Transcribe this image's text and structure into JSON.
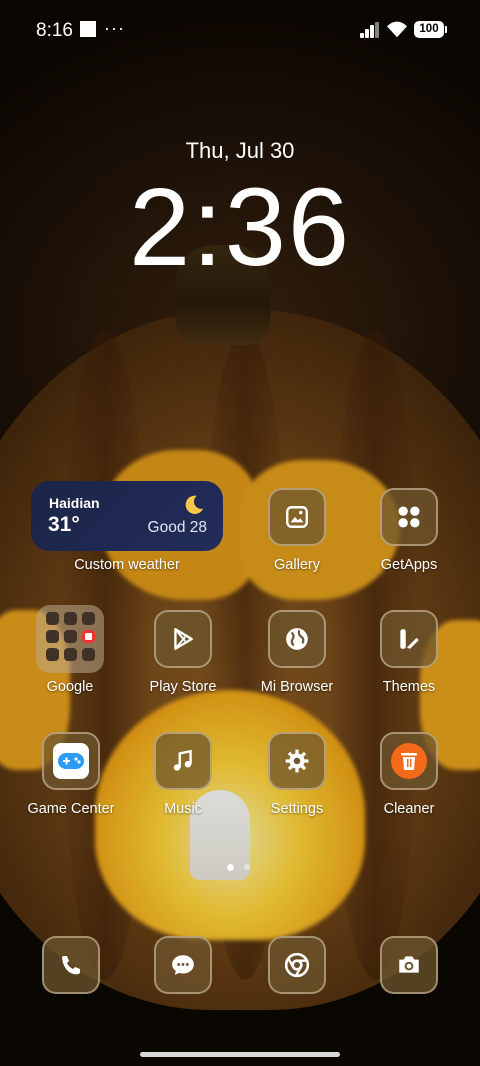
{
  "status_bar": {
    "time": "8:16",
    "more": "···",
    "battery": "100",
    "icons": [
      "square-notification-icon",
      "signal-icon",
      "wifi-icon",
      "battery-icon"
    ]
  },
  "lockclock": {
    "date": "Thu, Jul 30",
    "time": "2:36"
  },
  "weather_widget": {
    "city": "Haidian",
    "temperature": "31°",
    "air_quality": "Good 28",
    "icon": "crescent-moon-icon",
    "label": "Custom weather"
  },
  "apps": [
    {
      "label": "Gallery",
      "icon": "gallery-icon"
    },
    {
      "label": "GetApps",
      "icon": "getapps-icon"
    },
    {
      "label": "Google",
      "icon": "folder-icon"
    },
    {
      "label": "Play Store",
      "icon": "play-store-icon"
    },
    {
      "label": "Mi Browser",
      "icon": "globe-icon"
    },
    {
      "label": "Themes",
      "icon": "themes-icon"
    },
    {
      "label": "Game Center",
      "icon": "gamepad-icon"
    },
    {
      "label": "Music",
      "icon": "music-note-icon"
    },
    {
      "label": "Settings",
      "icon": "gear-icon"
    },
    {
      "label": "Cleaner",
      "icon": "trash-icon"
    }
  ],
  "dock": [
    {
      "icon": "phone-icon"
    },
    {
      "icon": "messages-icon"
    },
    {
      "icon": "chrome-icon"
    },
    {
      "icon": "camera-icon"
    }
  ],
  "colors": {
    "weather_bg": "#1b2448",
    "icon_tile": "#6e552d",
    "cleaner_accent": "#f56a1a",
    "game_center_accent": "#2b9cf2"
  }
}
